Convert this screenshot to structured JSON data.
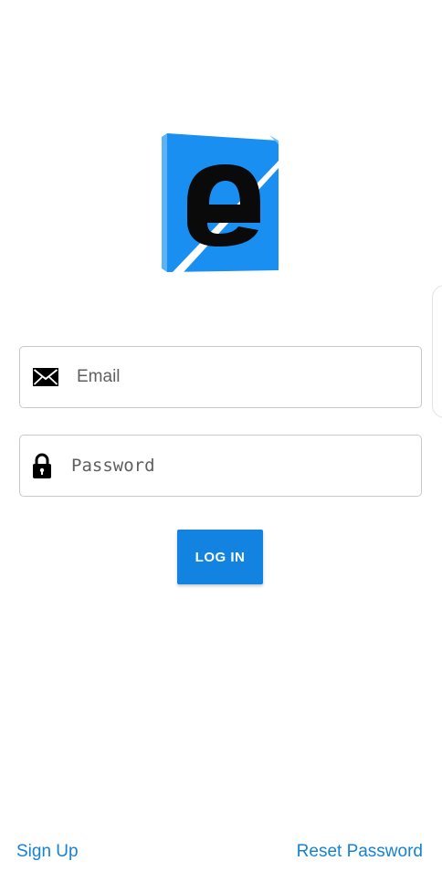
{
  "colors": {
    "accent": "#1283e0",
    "link": "#1682d4",
    "logo_blue": "#1a8ff2",
    "logo_light_blue": "#5ab3f7"
  },
  "logo": {
    "icon": "app-logo-letter-e",
    "text": "e"
  },
  "email_field": {
    "icon": "envelope-icon",
    "placeholder": "Email",
    "value": ""
  },
  "password_field": {
    "icon": "lock-icon",
    "placeholder": "Password",
    "value": ""
  },
  "login_button": {
    "label": "LOG IN"
  },
  "footer": {
    "signup_label": "Sign Up",
    "reset_label": "Reset Password"
  }
}
